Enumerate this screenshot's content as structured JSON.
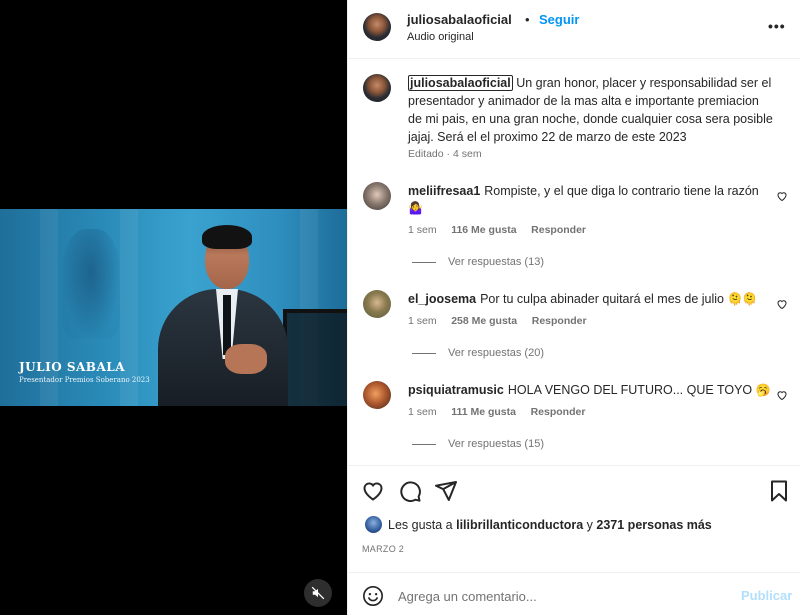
{
  "video": {
    "caption_name": "JULIO SABALA",
    "caption_sub": "Presentador Premios Soberano 2023",
    "mute_icon": "speaker-muted-icon"
  },
  "header": {
    "username": "juliosabalaoficial",
    "dot": "•",
    "follow_label": "Seguir",
    "audio_label": "Audio original",
    "more_label": "•••"
  },
  "caption": {
    "username": "juliosabalaoficial",
    "text": " Un gran honor, placer y responsabilidad ser el presentador y animador de la mas alta e importante premiacion de mi pais, en una gran noche, donde cualquier cosa sera posible jajaj. Será el el proximo 22 de marzo de este 2023",
    "edited": "Editado",
    "dot": "·",
    "time": "4 sem"
  },
  "comments": [
    {
      "username": "meliifresaa1",
      "text": "Rompiste, y el que diga lo contrario tiene la razón",
      "emoji": "🤷‍♀️",
      "time": "1 sem",
      "likes": "116 Me gusta",
      "reply_label": "Responder",
      "view_replies": "Ver respuestas (13)"
    },
    {
      "username": "el_joosema",
      "text": "Por tu culpa abinader quitará el mes de julio",
      "emoji": "🫠🫠",
      "time": "1 sem",
      "likes": "258 Me gusta",
      "reply_label": "Responder",
      "view_replies": "Ver respuestas (20)"
    },
    {
      "username": "psiquiatramusic",
      "text": "HOLA VENGO DEL FUTURO... QUE TOYO",
      "emoji": "🥱",
      "time": "1 sem",
      "likes": "111 Me gusta",
      "reply_label": "Responder",
      "view_replies": "Ver respuestas (15)"
    }
  ],
  "actions": {
    "like_icon": "heart-icon",
    "comment_icon": "comment-icon",
    "share_icon": "share-icon",
    "save_icon": "bookmark-icon"
  },
  "likes": {
    "prefix": "Les gusta a ",
    "user": "lilibrillanticonductora",
    "middle": " y ",
    "count": "2371 personas más"
  },
  "date": "MARZO 2",
  "comment_bar": {
    "placeholder": "Agrega un comentario...",
    "publish_label": "Publicar",
    "emoji_icon": "smiley-icon"
  }
}
